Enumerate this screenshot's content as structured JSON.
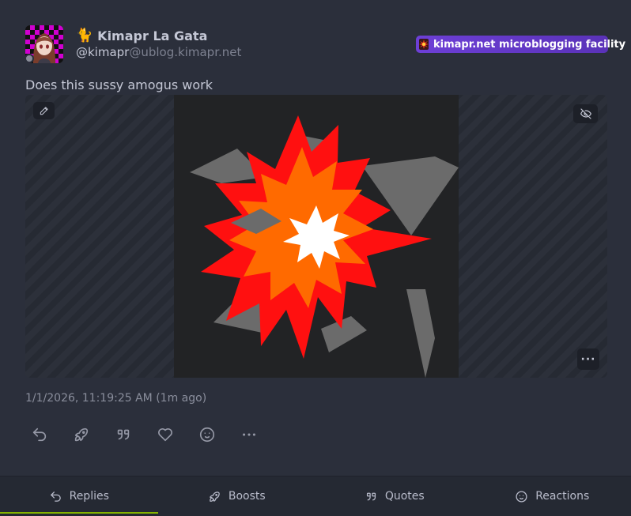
{
  "author": {
    "display_name": "Kimapr La Gata",
    "name_emoji": "🐈",
    "username": "@kimapr",
    "host": "@ublog.kimapr.net",
    "avatar_icon": "anime-girl-avatar",
    "online_status": "offline"
  },
  "instance": {
    "name": "kimapr.net microblogging facility",
    "icon": "explosion-icon",
    "color": "#6d3fd6"
  },
  "post": {
    "text": "Does this sussy amogus work",
    "timestamp": "1/1/2026, 11:19:25 AM (1m ago)"
  },
  "media": {
    "image_description_icon": "pencil-icon",
    "hide_icon": "eye-off-icon",
    "more_label": "···"
  },
  "actions": [
    {
      "name": "reply",
      "icon": "reply-icon"
    },
    {
      "name": "boost",
      "icon": "rocket-icon"
    },
    {
      "name": "quote",
      "icon": "quote-icon"
    },
    {
      "name": "like",
      "icon": "heart-icon"
    },
    {
      "name": "react",
      "icon": "smile-icon"
    },
    {
      "name": "more",
      "icon": "ellipsis-icon",
      "label": "···"
    }
  ],
  "tabs": [
    {
      "label": "Replies",
      "icon": "reply-icon",
      "active": true
    },
    {
      "label": "Boosts",
      "icon": "rocket-icon",
      "active": false
    },
    {
      "label": "Quotes",
      "icon": "quote-icon",
      "active": false
    },
    {
      "label": "Reactions",
      "icon": "smile-icon",
      "active": false
    }
  ],
  "colors": {
    "background": "#2b2f3b",
    "accent": "#86b300",
    "text": "#c5c8d6",
    "muted": "#8a8e9c"
  }
}
